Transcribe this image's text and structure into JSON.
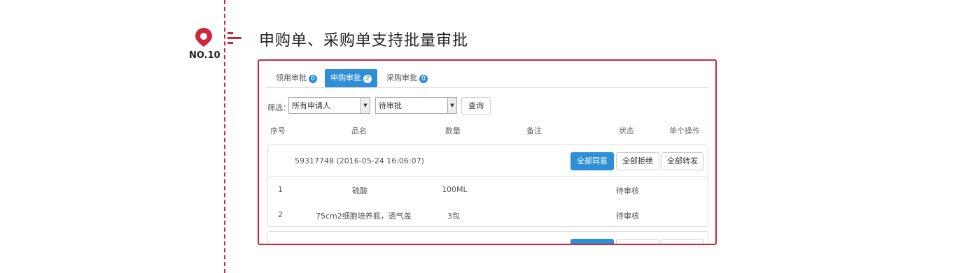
{
  "feature": {
    "number": "NO.10",
    "title": "申购单、采购单支持批量审批"
  },
  "tabs": [
    {
      "label": "领用审批",
      "badge": "0",
      "active": false
    },
    {
      "label": "申购审批",
      "badge": "2",
      "active": true
    },
    {
      "label": "采购审批",
      "badge": "0",
      "active": false
    }
  ],
  "filter": {
    "label": "筛选：",
    "applicant_select": "所有申请人",
    "status_select": "待审批",
    "query_button": "查询"
  },
  "table_headers": {
    "index": "序号",
    "name": "品名",
    "quantity": "数量",
    "note": "备注",
    "status": "状态",
    "action": "单个操作"
  },
  "group": {
    "order": "59317748 (2016-05-24 16:06:07)",
    "approve_all": "全部同意",
    "reject_all": "全部拒绝",
    "forward_all": "全部转发",
    "items": [
      {
        "index": "1",
        "name": "硫酸",
        "quantity": "100ML",
        "note": "",
        "status": "待审核"
      },
      {
        "index": "2",
        "name": "75cm2细胞培养瓶，透气盖",
        "quantity": "3包",
        "note": "",
        "status": "待审核"
      }
    ]
  },
  "colors": {
    "accent_red": "#d0263a",
    "primary_blue": "#2e8fd6"
  }
}
